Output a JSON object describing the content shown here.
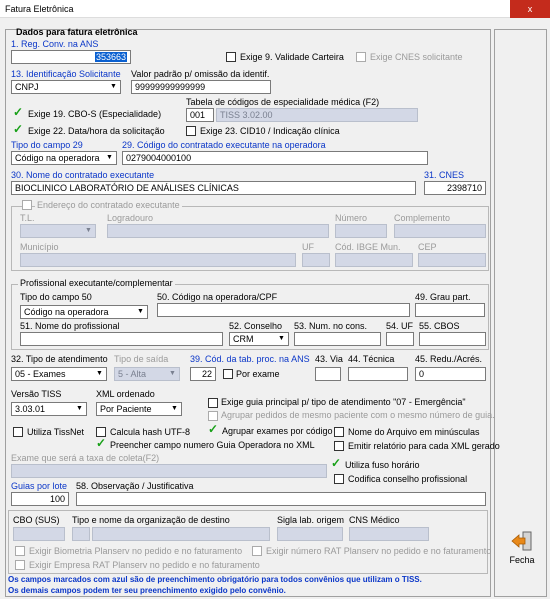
{
  "window": {
    "title": "Fatura Eletrônica",
    "close": "x"
  },
  "section_title": "Dados para fatura eletrônica",
  "reg_conv": {
    "label": "1. Reg. Conv. na ANS",
    "value": "353663"
  },
  "exige9": {
    "label": "Exige 9. Validade Carteira"
  },
  "exige_cnes": {
    "label": "Exige CNES solicitante"
  },
  "ident_solic": {
    "label": "13. Identificação Solicitante",
    "value": "CNPJ"
  },
  "valor_padrao": {
    "label": "Valor padrão p/ omissão da identif.",
    "value": "99999999999999"
  },
  "tabela_cod": {
    "label": "Tabela de códigos de especialidade médica (F2)",
    "code": "001",
    "desc": "TISS 3.02.00"
  },
  "exige19": {
    "label": "Exige 19. CBO-S (Especialidade)"
  },
  "exige22": {
    "label": "Exige 22. Data/hora da solicitação"
  },
  "exige23": {
    "label": "Exige 23. CID10 / Indicação clínica"
  },
  "tipo29": {
    "label": "Tipo do campo 29",
    "value": "Código na operadora"
  },
  "cod29": {
    "label": "29. Código do contratado executante na operadora",
    "value": "0279004000100"
  },
  "nome30": {
    "label": "30. Nome do contratado executante",
    "value": "BIOCLINICO LABORATÓRIO DE ANÁLISES CLÍNICAS"
  },
  "cnes31": {
    "label": "31. CNES",
    "value": "2398710"
  },
  "endereco": {
    "label": "Endereço do contratado executante",
    "tl": "T.L.",
    "logradouro": "Logradouro",
    "numero": "Número",
    "complemento": "Complemento",
    "municipio": "Município",
    "uf": "UF",
    "ibge": "Cód. IBGE Mun.",
    "cep": "CEP"
  },
  "prof": {
    "title": "Profissional executante/complementar",
    "tipo50_label": "Tipo do campo 50",
    "tipo50_value": "Código na operadora",
    "cod50_label": "50. Código na operadora/CPF",
    "grau_label": "49. Grau part.",
    "nome51_label": "51. Nome do profissional",
    "conselho_label": "52. Conselho",
    "conselho_value": "CRM",
    "numcons_label": "53. Num. no cons.",
    "uf54_label": "54. UF",
    "cbos55_label": "55. CBOS"
  },
  "atend": {
    "tipo_label": "32. Tipo de atendimento",
    "tipo_value": "05 - Exames",
    "saida_label": "Tipo de saída",
    "saida_value": "5 - Alta",
    "tab39_label": "39. Cód. da tab. proc. na ANS",
    "tab39_value": "22",
    "por_exame": "Por exame",
    "via_label": "43. Via",
    "tecnica_label": "44. Técnica",
    "redu_label": "45. Redu./Acrés.",
    "redu_value": "0"
  },
  "versao": {
    "label": "Versão TISS",
    "value": "3.03.01"
  },
  "xml_ord": {
    "label": "XML ordenado",
    "value": "Por Paciente"
  },
  "opts": {
    "guia_principal": "Exige guia principal p/ tipo de atendimento \"07 - Emergência\"",
    "agrupar_pedidos": "Agrupar pedidos de mesmo paciente com o mesmo número de guia.",
    "tissnet": "Utiliza TissNet",
    "hash": "Calcula hash UTF-8",
    "agrupar_exames": "Agrupar exames por código",
    "minusculas": "Nome do Arquivo em minúsculas",
    "preencher": "Preencher campo numero Guia Operadora no XML",
    "relatorio": "Emitir relatório para cada XML gerado",
    "fuso": "Utiliza fuso horário",
    "codifica": "Codifica conselho profissional"
  },
  "exame_taxa": {
    "label": "Exame que será a taxa de coleta(F2)"
  },
  "guias_lote": {
    "label": "Guias por lote",
    "value": "100"
  },
  "obs58": {
    "label": "58. Observação / Justificativa"
  },
  "bottom": {
    "cbo": "CBO (SUS)",
    "tipo_org": "Tipo e nome da organização de destino",
    "sigla": "Sigla lab. origem",
    "cns": "CNS Médico",
    "biometria": "Exigir Biometria Planserv no pedido e no faturamento",
    "rat": "Exigir número RAT Planserv no pedido e no faturamento",
    "empresa_rat": "Exigir Empresa RAT Planserv no pedido e no faturamento"
  },
  "footer": {
    "line1": "Os campos marcados com azul são de preenchimento obrigatório para todos convênios que utilizam o TISS.",
    "line2": "Os demais campos podem ter seu preenchimento exigido pelo convênio."
  },
  "fecha": {
    "label": "Fecha",
    "icon": "exit-arrow-icon"
  },
  "colors": {
    "blue_label": "#0a36c8",
    "close_red": "#c42b1c",
    "disabled_fill": "#d3d8e6",
    "check_green": "#18a018"
  }
}
